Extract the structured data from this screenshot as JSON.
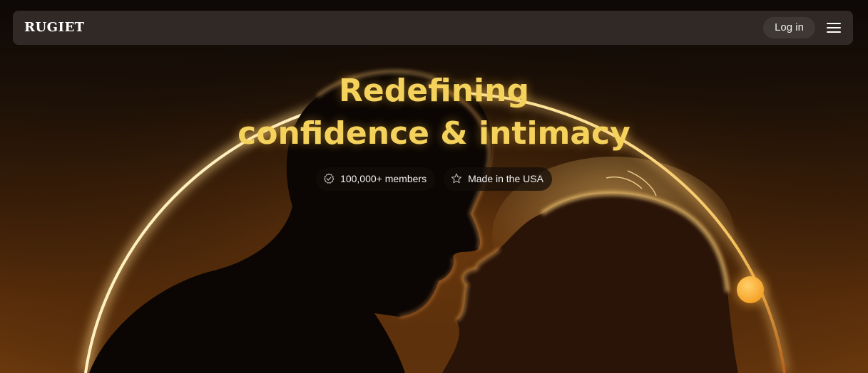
{
  "brand": {
    "logo_text": "RUGIET"
  },
  "nav": {
    "login_label": "Log in",
    "menu_icon": "hamburger-menu-icon"
  },
  "hero": {
    "headline_line1": "Redefining",
    "headline_line2": "confidence & intimacy",
    "image_alt": "Backlit couple about to kiss framed by a glowing arc",
    "badges": [
      {
        "icon": "verified-check-icon",
        "label": "100,000+ members"
      },
      {
        "icon": "star-outline-icon",
        "label": "Made in the USA"
      }
    ]
  },
  "colors": {
    "accent_yellow": "#f5d25c",
    "ring_glow": "#fde7a0",
    "orb": "#fbb03b",
    "background_top": "#0d0806",
    "background_bottom": "#6a380d"
  }
}
